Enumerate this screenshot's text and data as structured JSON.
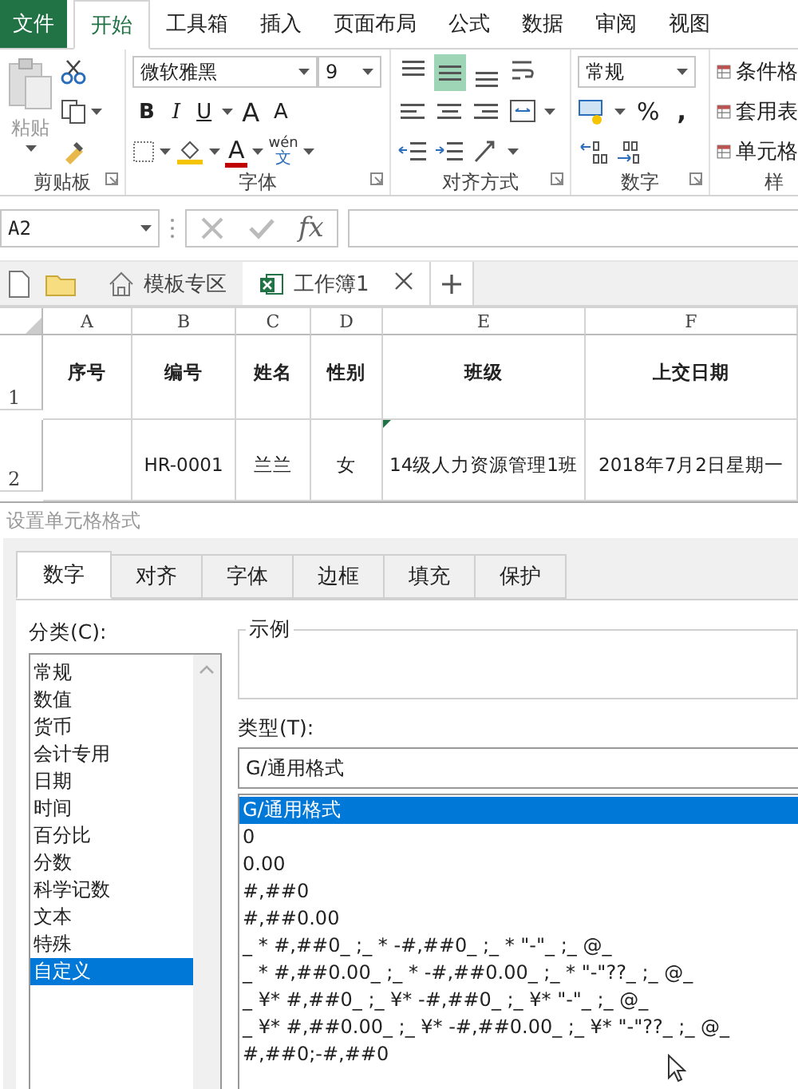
{
  "menu_tabs": [
    {
      "label": "文件",
      "selected": false,
      "kind": "file"
    },
    {
      "label": "开始",
      "selected": true,
      "kind": "tab"
    },
    {
      "label": "工具箱",
      "selected": false,
      "kind": "tab"
    },
    {
      "label": "插入",
      "selected": false,
      "kind": "tab"
    },
    {
      "label": "页面布局",
      "selected": false,
      "kind": "tab"
    },
    {
      "label": "公式",
      "selected": false,
      "kind": "tab"
    },
    {
      "label": "数据",
      "selected": false,
      "kind": "tab"
    },
    {
      "label": "审阅",
      "selected": false,
      "kind": "tab"
    },
    {
      "label": "视图",
      "selected": false,
      "kind": "tab"
    }
  ],
  "ribbon": {
    "clipboard": {
      "paste_label": "粘贴",
      "group_label": "剪贴板"
    },
    "font": {
      "font_name": "微软雅黑",
      "font_size": "9",
      "bold": "B",
      "italic": "I",
      "underline": "U",
      "grow": "A",
      "shrink": "A",
      "font_color": "A",
      "phonetic": "wén",
      "phonetic_sub": "文",
      "group_label": "字体"
    },
    "alignment": {
      "group_label": "对齐方式"
    },
    "number": {
      "format": "常规",
      "percent": "%",
      "comma": ",",
      "group_label": "数字"
    },
    "styles": {
      "items": [
        "条件格",
        "套用表",
        "单元格"
      ],
      "group_label": "样"
    }
  },
  "formula_bar": {
    "name_box": "A2",
    "fx": "fx"
  },
  "file_tabs": [
    {
      "label": "模板专区",
      "selected": false,
      "kind": "home"
    },
    {
      "label": "工作簿1",
      "selected": true,
      "kind": "workbook"
    }
  ],
  "sheet": {
    "columns": [
      "A",
      "B",
      "C",
      "D",
      "E",
      "F"
    ],
    "rows": [
      {
        "header": "1",
        "kind": "heading",
        "cells": [
          {
            "text": "序号"
          },
          {
            "text": "编号"
          },
          {
            "text": "姓名"
          },
          {
            "text": "性别"
          },
          {
            "text": "班级"
          },
          {
            "text": "上交日期"
          }
        ]
      },
      {
        "header": "2",
        "kind": "data",
        "cells": [
          {},
          {
            "text": "HR-0001"
          },
          {
            "text": "兰兰"
          },
          {
            "text": "女"
          },
          {
            "text": "14级人力资源管理1班",
            "flag": true
          },
          {
            "text": "2018年7月2日星期一"
          }
        ]
      }
    ]
  },
  "dialog": {
    "title": "设置单元格格式",
    "tabs": [
      {
        "label": "数字",
        "selected": true
      },
      {
        "label": "对齐",
        "selected": false
      },
      {
        "label": "字体",
        "selected": false
      },
      {
        "label": "边框",
        "selected": false
      },
      {
        "label": "填充",
        "selected": false
      },
      {
        "label": "保护",
        "selected": false
      }
    ],
    "category_label": "分类(C):",
    "categories": [
      {
        "label": "常规",
        "selected": false
      },
      {
        "label": "数值",
        "selected": false
      },
      {
        "label": "货币",
        "selected": false
      },
      {
        "label": "会计专用",
        "selected": false
      },
      {
        "label": "日期",
        "selected": false
      },
      {
        "label": "时间",
        "selected": false
      },
      {
        "label": "百分比",
        "selected": false
      },
      {
        "label": "分数",
        "selected": false
      },
      {
        "label": "科学记数",
        "selected": false
      },
      {
        "label": "文本",
        "selected": false
      },
      {
        "label": "特殊",
        "selected": false
      },
      {
        "label": "自定义",
        "selected": true
      }
    ],
    "sample_label": "示例",
    "type_label": "类型(T):",
    "type_value": "G/通用格式",
    "formats": [
      {
        "label": "G/通用格式",
        "selected": true
      },
      {
        "label": "0",
        "selected": false
      },
      {
        "label": "0.00",
        "selected": false
      },
      {
        "label": "#,##0",
        "selected": false
      },
      {
        "label": "#,##0.00",
        "selected": false
      },
      {
        "label": "_ * #,##0_ ;_ * -#,##0_ ;_ * \"-\"_ ;_ @_",
        "selected": false
      },
      {
        "label": "_ * #,##0.00_ ;_ * -#,##0.00_ ;_ * \"-\"??_ ;_ @_",
        "selected": false
      },
      {
        "label": "_ ¥* #,##0_ ;_ ¥* -#,##0_ ;_ ¥* \"-\"_ ;_ @_",
        "selected": false
      },
      {
        "label": "_ ¥* #,##0.00_ ;_ ¥* -#,##0.00_ ;_ ¥* \"-\"??_ ;_ @_",
        "selected": false
      },
      {
        "label": "#,##0;-#,##0",
        "selected": false
      }
    ]
  }
}
